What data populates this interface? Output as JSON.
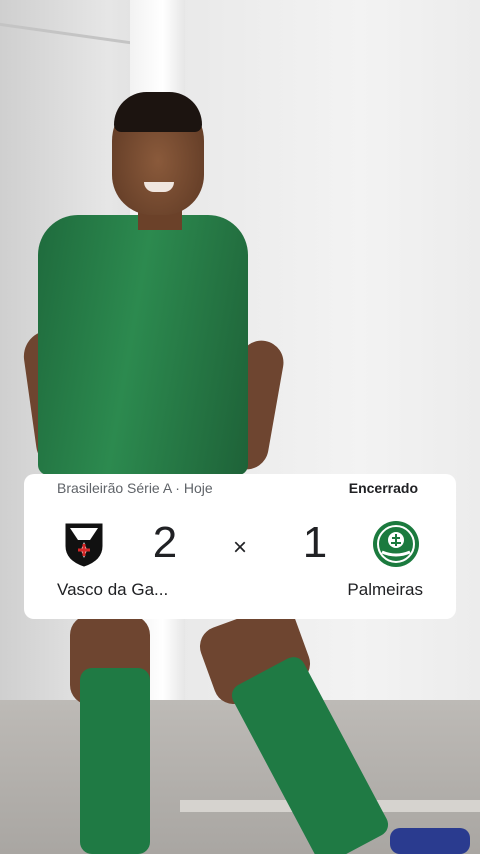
{
  "match_card": {
    "competition": "Brasileirão Série A · Hoje",
    "status": "Encerrado",
    "home": {
      "team": "Vasco da Ga...",
      "score": "2",
      "crest_icon": "vasco-crest-icon"
    },
    "separator": "×",
    "away": {
      "team": "Palmeiras",
      "score": "1",
      "crest_icon": "palmeiras-crest-icon"
    }
  },
  "colors": {
    "card_bg": "#ffffff",
    "text_primary": "#202124",
    "text_secondary": "#5f6368",
    "palmeiras_green": "#1b7a3e"
  }
}
